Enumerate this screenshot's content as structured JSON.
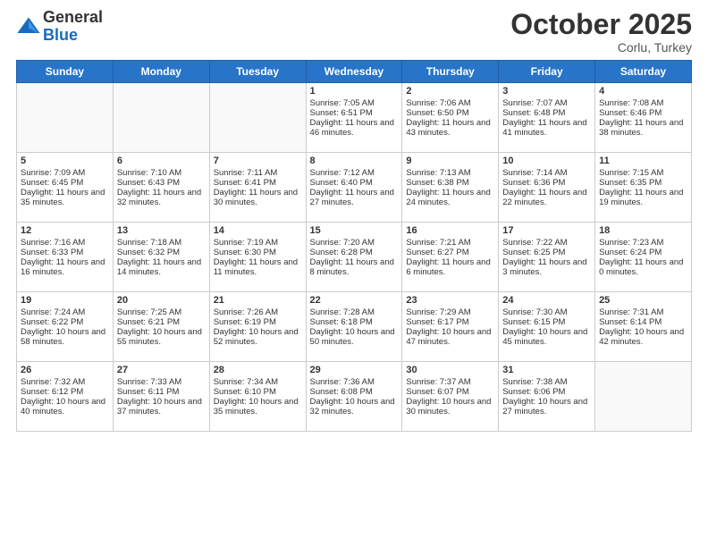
{
  "logo": {
    "general": "General",
    "blue": "Blue"
  },
  "header": {
    "month": "October 2025",
    "location": "Corlu, Turkey"
  },
  "days_of_week": [
    "Sunday",
    "Monday",
    "Tuesday",
    "Wednesday",
    "Thursday",
    "Friday",
    "Saturday"
  ],
  "weeks": [
    [
      {
        "day": "",
        "info": ""
      },
      {
        "day": "",
        "info": ""
      },
      {
        "day": "",
        "info": ""
      },
      {
        "day": "1",
        "info": "Sunrise: 7:05 AM\nSunset: 6:51 PM\nDaylight: 11 hours and 46 minutes."
      },
      {
        "day": "2",
        "info": "Sunrise: 7:06 AM\nSunset: 6:50 PM\nDaylight: 11 hours and 43 minutes."
      },
      {
        "day": "3",
        "info": "Sunrise: 7:07 AM\nSunset: 6:48 PM\nDaylight: 11 hours and 41 minutes."
      },
      {
        "day": "4",
        "info": "Sunrise: 7:08 AM\nSunset: 6:46 PM\nDaylight: 11 hours and 38 minutes."
      }
    ],
    [
      {
        "day": "5",
        "info": "Sunrise: 7:09 AM\nSunset: 6:45 PM\nDaylight: 11 hours and 35 minutes."
      },
      {
        "day": "6",
        "info": "Sunrise: 7:10 AM\nSunset: 6:43 PM\nDaylight: 11 hours and 32 minutes."
      },
      {
        "day": "7",
        "info": "Sunrise: 7:11 AM\nSunset: 6:41 PM\nDaylight: 11 hours and 30 minutes."
      },
      {
        "day": "8",
        "info": "Sunrise: 7:12 AM\nSunset: 6:40 PM\nDaylight: 11 hours and 27 minutes."
      },
      {
        "day": "9",
        "info": "Sunrise: 7:13 AM\nSunset: 6:38 PM\nDaylight: 11 hours and 24 minutes."
      },
      {
        "day": "10",
        "info": "Sunrise: 7:14 AM\nSunset: 6:36 PM\nDaylight: 11 hours and 22 minutes."
      },
      {
        "day": "11",
        "info": "Sunrise: 7:15 AM\nSunset: 6:35 PM\nDaylight: 11 hours and 19 minutes."
      }
    ],
    [
      {
        "day": "12",
        "info": "Sunrise: 7:16 AM\nSunset: 6:33 PM\nDaylight: 11 hours and 16 minutes."
      },
      {
        "day": "13",
        "info": "Sunrise: 7:18 AM\nSunset: 6:32 PM\nDaylight: 11 hours and 14 minutes."
      },
      {
        "day": "14",
        "info": "Sunrise: 7:19 AM\nSunset: 6:30 PM\nDaylight: 11 hours and 11 minutes."
      },
      {
        "day": "15",
        "info": "Sunrise: 7:20 AM\nSunset: 6:28 PM\nDaylight: 11 hours and 8 minutes."
      },
      {
        "day": "16",
        "info": "Sunrise: 7:21 AM\nSunset: 6:27 PM\nDaylight: 11 hours and 6 minutes."
      },
      {
        "day": "17",
        "info": "Sunrise: 7:22 AM\nSunset: 6:25 PM\nDaylight: 11 hours and 3 minutes."
      },
      {
        "day": "18",
        "info": "Sunrise: 7:23 AM\nSunset: 6:24 PM\nDaylight: 11 hours and 0 minutes."
      }
    ],
    [
      {
        "day": "19",
        "info": "Sunrise: 7:24 AM\nSunset: 6:22 PM\nDaylight: 10 hours and 58 minutes."
      },
      {
        "day": "20",
        "info": "Sunrise: 7:25 AM\nSunset: 6:21 PM\nDaylight: 10 hours and 55 minutes."
      },
      {
        "day": "21",
        "info": "Sunrise: 7:26 AM\nSunset: 6:19 PM\nDaylight: 10 hours and 52 minutes."
      },
      {
        "day": "22",
        "info": "Sunrise: 7:28 AM\nSunset: 6:18 PM\nDaylight: 10 hours and 50 minutes."
      },
      {
        "day": "23",
        "info": "Sunrise: 7:29 AM\nSunset: 6:17 PM\nDaylight: 10 hours and 47 minutes."
      },
      {
        "day": "24",
        "info": "Sunrise: 7:30 AM\nSunset: 6:15 PM\nDaylight: 10 hours and 45 minutes."
      },
      {
        "day": "25",
        "info": "Sunrise: 7:31 AM\nSunset: 6:14 PM\nDaylight: 10 hours and 42 minutes."
      }
    ],
    [
      {
        "day": "26",
        "info": "Sunrise: 7:32 AM\nSunset: 6:12 PM\nDaylight: 10 hours and 40 minutes."
      },
      {
        "day": "27",
        "info": "Sunrise: 7:33 AM\nSunset: 6:11 PM\nDaylight: 10 hours and 37 minutes."
      },
      {
        "day": "28",
        "info": "Sunrise: 7:34 AM\nSunset: 6:10 PM\nDaylight: 10 hours and 35 minutes."
      },
      {
        "day": "29",
        "info": "Sunrise: 7:36 AM\nSunset: 6:08 PM\nDaylight: 10 hours and 32 minutes."
      },
      {
        "day": "30",
        "info": "Sunrise: 7:37 AM\nSunset: 6:07 PM\nDaylight: 10 hours and 30 minutes."
      },
      {
        "day": "31",
        "info": "Sunrise: 7:38 AM\nSunset: 6:06 PM\nDaylight: 10 hours and 27 minutes."
      },
      {
        "day": "",
        "info": ""
      }
    ]
  ]
}
